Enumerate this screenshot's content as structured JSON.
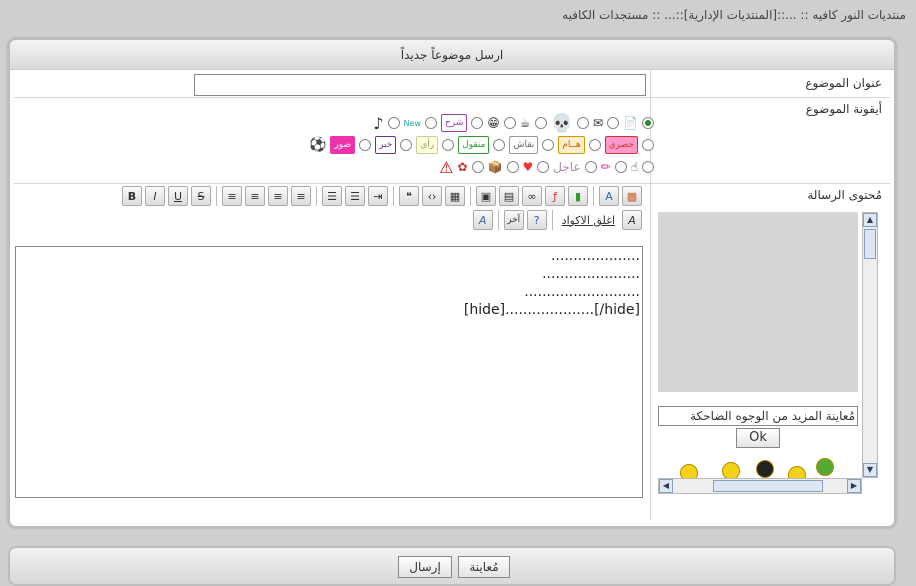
{
  "breadcrumb": "منتديات النور كافيه :: ...::[المنتديات الإدارية]::... :: مستجدات الكافيه",
  "panel": {
    "title": "ارسل موضوعاً جديداً"
  },
  "form": {
    "subject_label": "عنوان الموضوع",
    "icon_label": "أيقونة الموضوع",
    "message_label": "مُحتوى الرسالة",
    "subject_value": ""
  },
  "icon_tags": [
    "New",
    "شرح",
    "حصري",
    "هــام",
    "نقاش",
    "منقول",
    "رأي",
    "خبر",
    "صور",
    "عاجل"
  ],
  "toolbar": {
    "close_tags": "اغلق الاكواد",
    "more": "آخر"
  },
  "editor_lines": [
    "....................",
    "......................",
    "..........................",
    "[hide]....................[/hide]"
  ],
  "smilies": {
    "select_value": "مُعاينة المزيد من الوجوه الضاحكة",
    "ok": "Ok"
  },
  "buttons": {
    "send": "إرسال",
    "preview": "مُعاينة"
  }
}
